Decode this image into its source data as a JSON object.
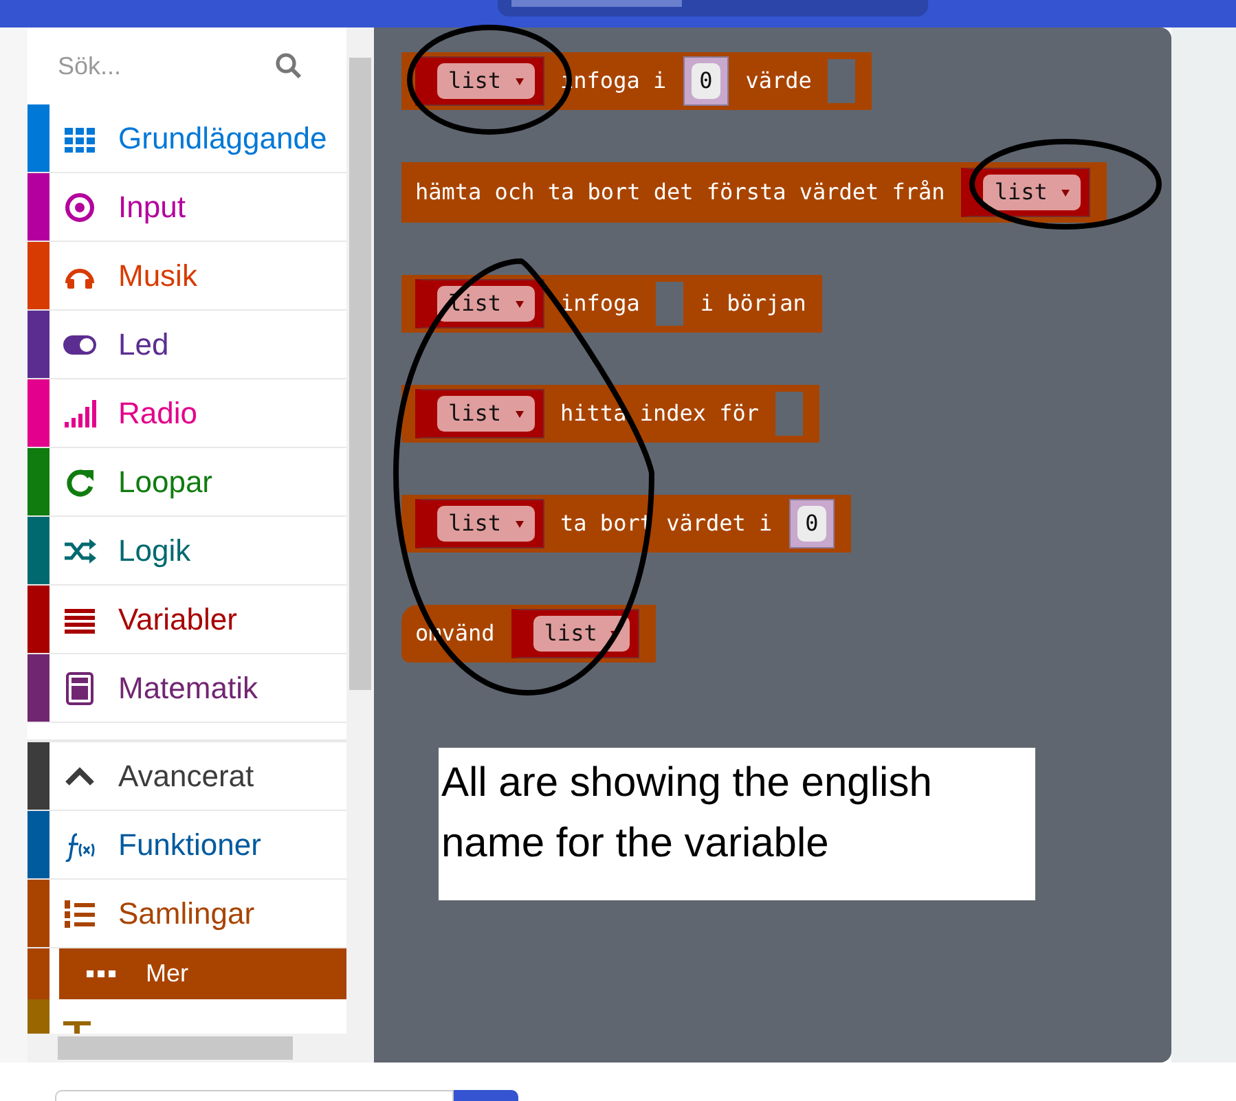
{
  "toolbox": {
    "search": {
      "placeholder": "Sök..."
    },
    "categories": [
      {
        "label": "Grundläggande",
        "color": "#0078d7",
        "selected": false
      },
      {
        "label": "Input",
        "color": "#b4009e",
        "selected": false
      },
      {
        "label": "Musik",
        "color": "#d83b01",
        "selected": false
      },
      {
        "label": "Led",
        "color": "#5c2d91",
        "selected": false
      },
      {
        "label": "Radio",
        "color": "#e3008c",
        "selected": false
      },
      {
        "label": "Loopar",
        "color": "#107c10",
        "selected": false
      },
      {
        "label": "Logik",
        "color": "#006970",
        "selected": false
      },
      {
        "label": "Variabler",
        "color": "#a80000",
        "selected": false
      },
      {
        "label": "Matematik",
        "color": "#712672",
        "selected": false
      }
    ],
    "advanced_categories": [
      {
        "label": "Avancerat",
        "color": "#3c3c3c",
        "selected": false
      },
      {
        "label": "Funktioner",
        "color": "#005a9e",
        "selected": false
      },
      {
        "label": "Samlingar",
        "color": "#a94400",
        "selected": false,
        "children": [
          {
            "label": "Mer",
            "selected": true
          }
        ]
      },
      {
        "color": "#996600",
        "selected": false
      }
    ]
  },
  "blocks": [
    {
      "parts": [
        {
          "kind": "var",
          "text": "list"
        },
        {
          "kind": "text",
          "text": "infoga i"
        },
        {
          "kind": "num",
          "text": "0"
        },
        {
          "kind": "text",
          "text": "värde"
        },
        {
          "kind": "slot"
        }
      ]
    },
    {
      "parts": [
        {
          "kind": "text",
          "text": "hämta och ta bort det första värdet från"
        },
        {
          "kind": "var",
          "text": "list"
        }
      ]
    },
    {
      "parts": [
        {
          "kind": "var",
          "text": "list"
        },
        {
          "kind": "text",
          "text": "infoga"
        },
        {
          "kind": "slot"
        },
        {
          "kind": "text",
          "text": "i början"
        }
      ]
    },
    {
      "parts": [
        {
          "kind": "var",
          "text": "list"
        },
        {
          "kind": "text",
          "text": "hitta index för"
        },
        {
          "kind": "slot"
        }
      ]
    },
    {
      "parts": [
        {
          "kind": "var",
          "text": "list"
        },
        {
          "kind": "text",
          "text": "ta bort värdet i"
        },
        {
          "kind": "num",
          "text": "0"
        }
      ]
    },
    {
      "parts": [
        {
          "kind": "text",
          "text": "omvänd"
        },
        {
          "kind": "var",
          "text": "list"
        }
      ]
    }
  ],
  "annotation": {
    "note": "All are showing the english name for the variable"
  }
}
